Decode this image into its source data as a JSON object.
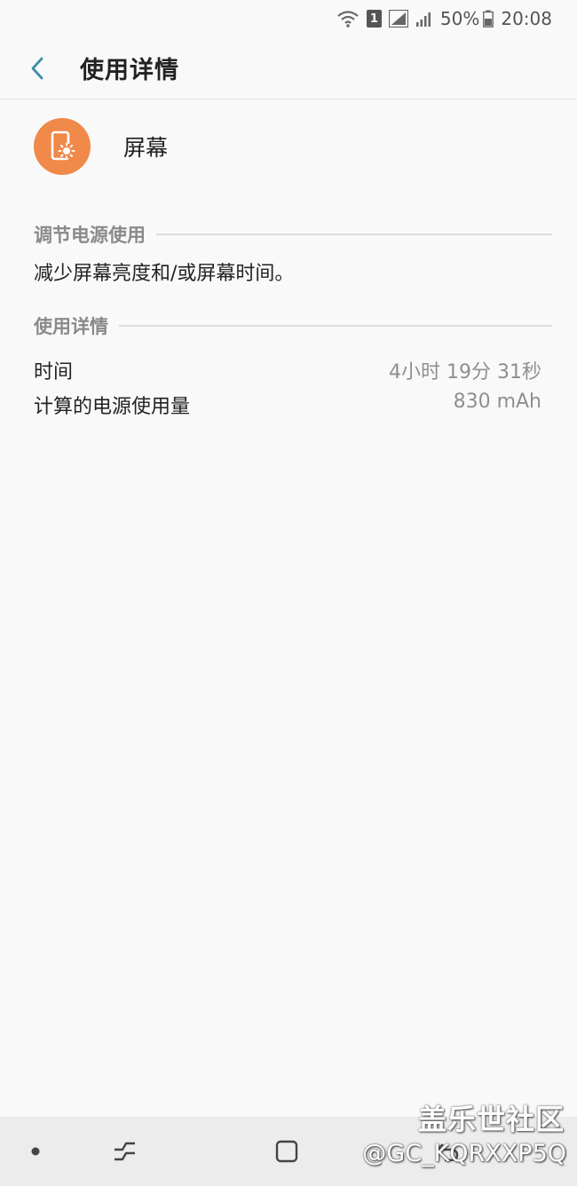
{
  "status_bar": {
    "sim_label": "1",
    "battery": "50%",
    "time": "20:08"
  },
  "app_bar": {
    "title": "使用详情"
  },
  "app": {
    "name": "屏幕",
    "icon": "screen-brightness-icon",
    "icon_color": "#f0894a"
  },
  "power_section": {
    "header": "调节电源使用",
    "description": "减少屏幕亮度和/或屏幕时间。"
  },
  "details_section": {
    "header": "使用详情",
    "rows": [
      {
        "label": "时间",
        "value": "4小时 19分 31秒"
      },
      {
        "label": "计算的电源使用量",
        "value": "830 mAh"
      }
    ]
  },
  "watermark": {
    "site": "盖乐世社区",
    "user": "@GC_KQRXXP5Q"
  },
  "colors": {
    "accent": "#3d8ea8",
    "background": "#f9f9f9"
  }
}
